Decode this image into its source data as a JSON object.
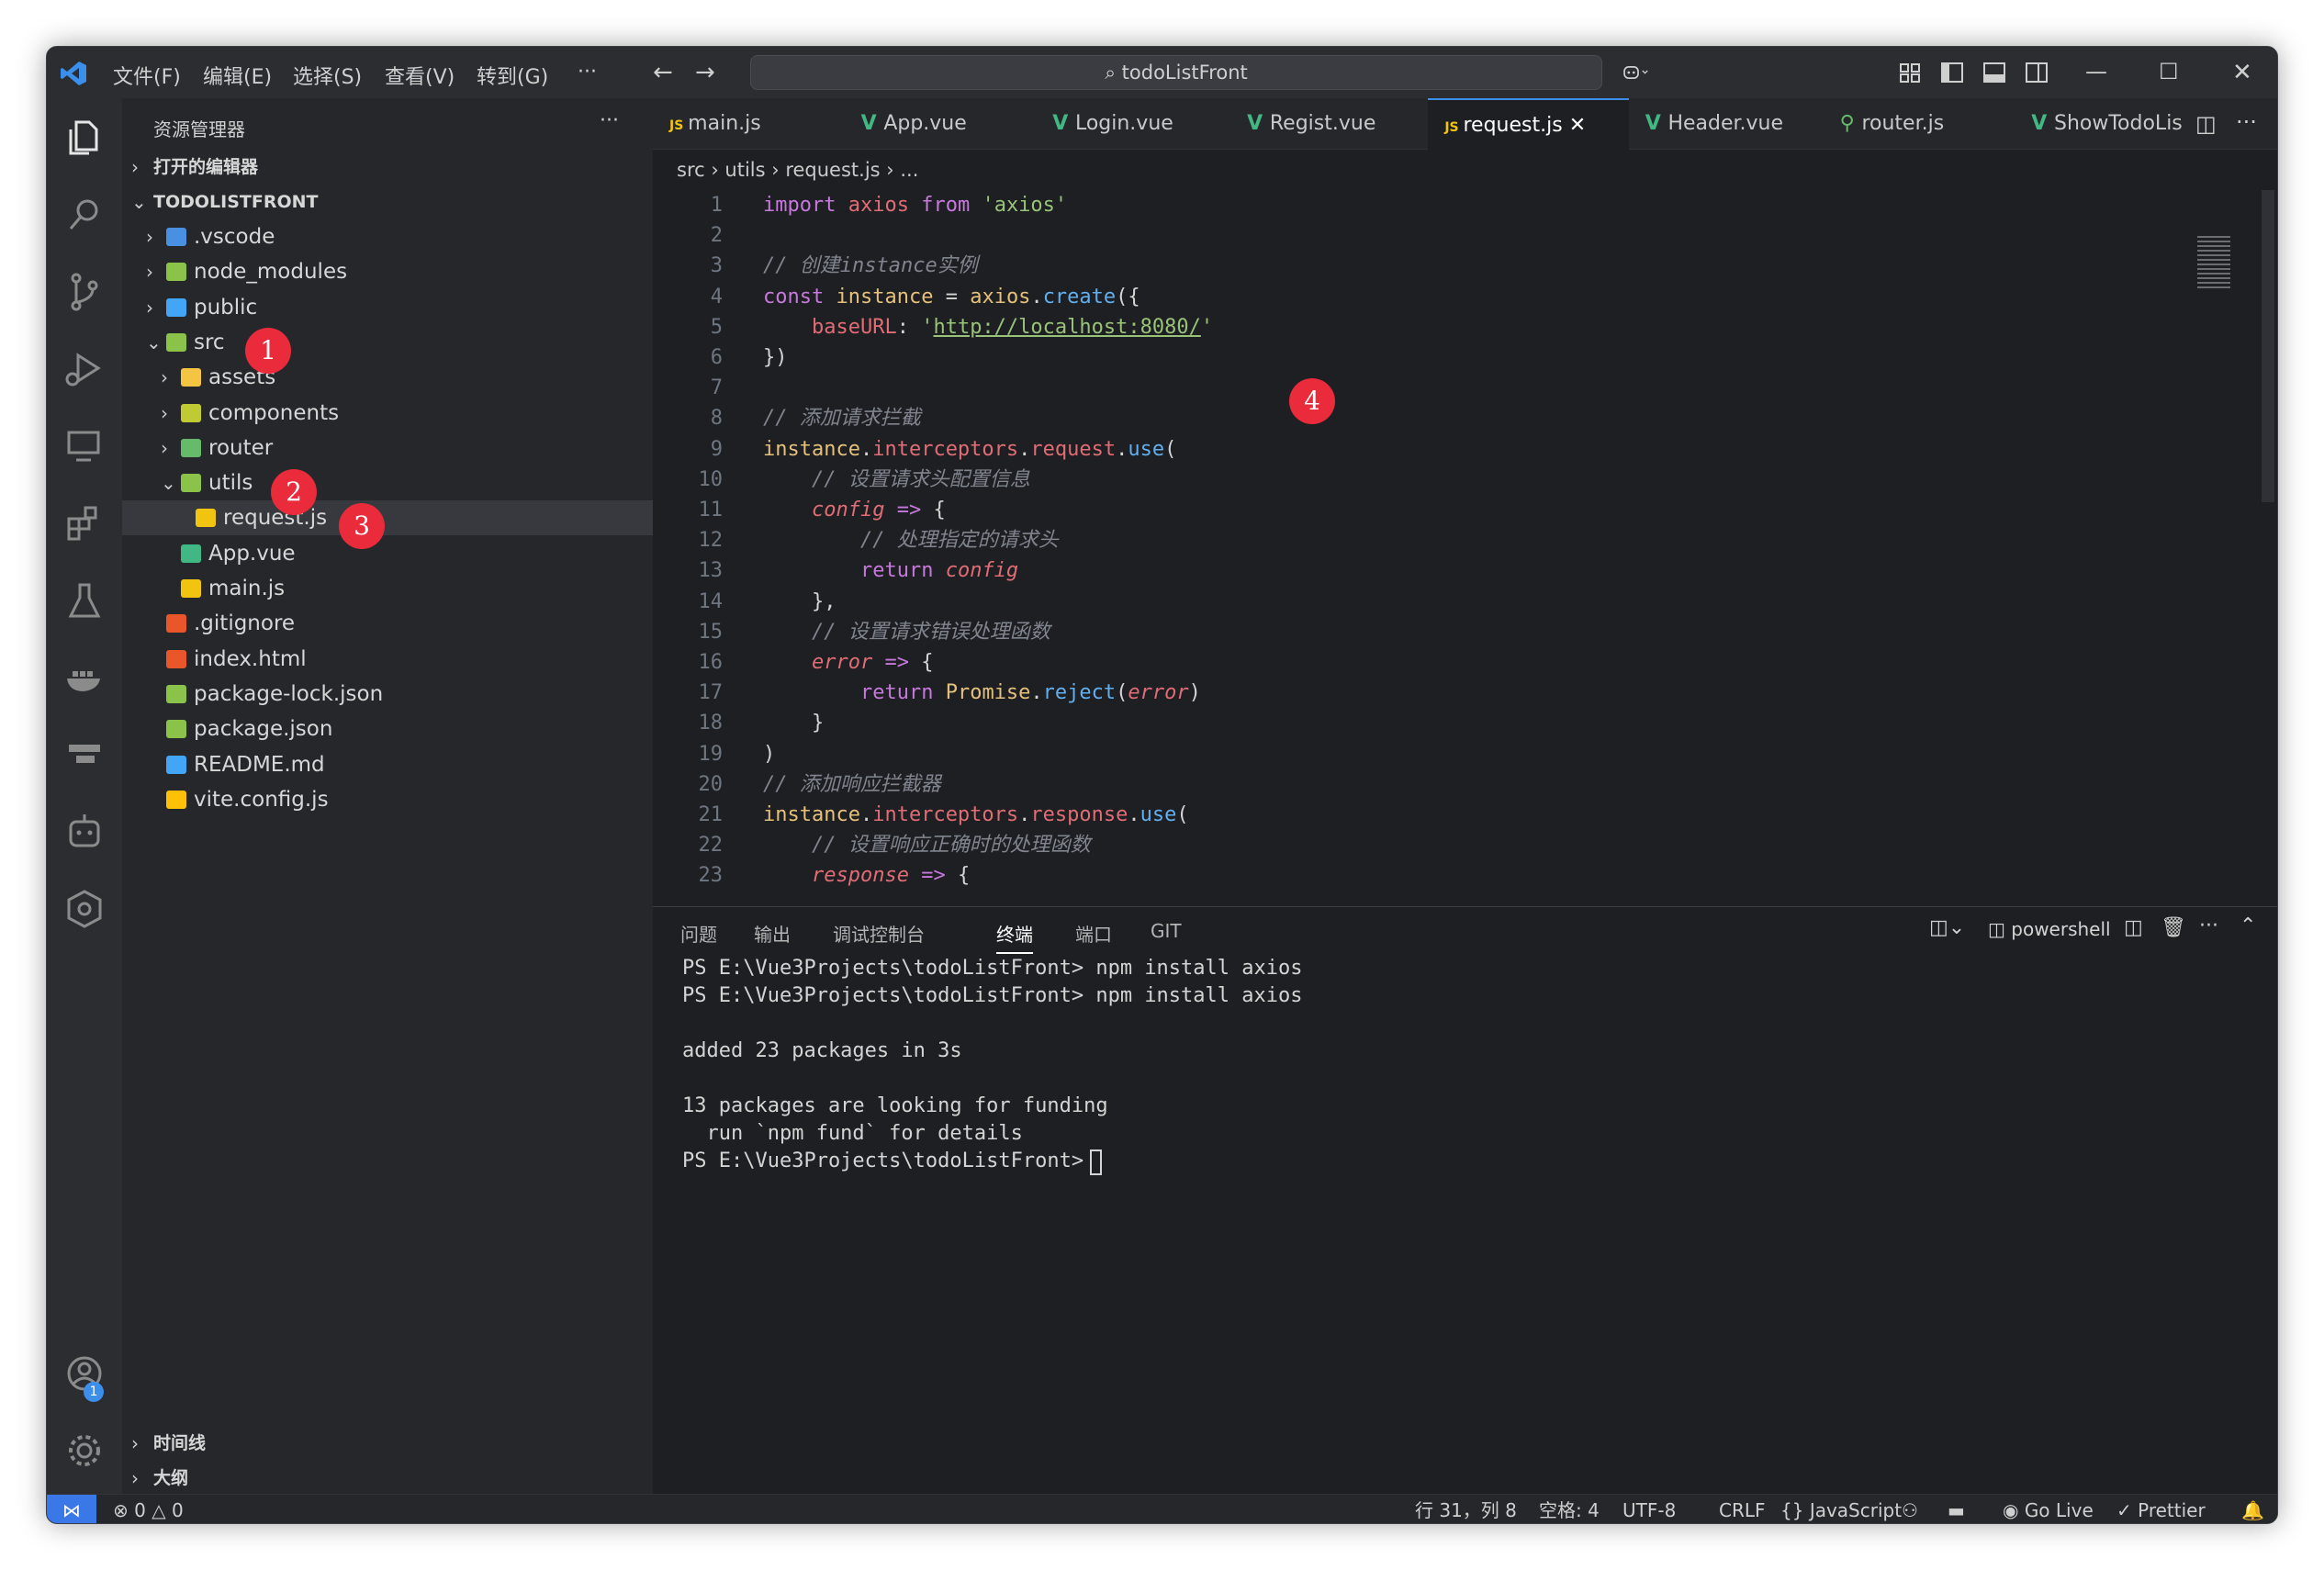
{
  "titlebar": {
    "menus": [
      "文件(F)",
      "编辑(E)",
      "选择(S)",
      "查看(V)",
      "转到(G)",
      "···"
    ],
    "search_text": "todoListFront"
  },
  "sidebar": {
    "header": "资源管理器",
    "more": "···",
    "open_editors": "打开的编辑器",
    "project": "TODOLISTFRONT",
    "tree": [
      {
        "label": ".vscode",
        "level": 1,
        "chev": "›",
        "color": "#4a90e2"
      },
      {
        "label": "node_modules",
        "level": 1,
        "chev": "›",
        "color": "#8bc34a"
      },
      {
        "label": "public",
        "level": 1,
        "chev": "›",
        "color": "#42a5f5"
      },
      {
        "label": "src",
        "level": 1,
        "chev": "⌄",
        "color": "#8bc34a"
      },
      {
        "label": "assets",
        "level": 2,
        "chev": "›",
        "color": "#f4c542"
      },
      {
        "label": "components",
        "level": 2,
        "chev": "›",
        "color": "#c0ca33"
      },
      {
        "label": "router",
        "level": 2,
        "chev": "›",
        "color": "#66bb6a"
      },
      {
        "label": "utils",
        "level": 2,
        "chev": "⌄",
        "color": "#8bc34a"
      },
      {
        "label": "request.js",
        "level": 3,
        "chev": "",
        "color": "#f1c40f"
      },
      {
        "label": "App.vue",
        "level": 2,
        "chev": "",
        "color": "#41b883"
      },
      {
        "label": "main.js",
        "level": 2,
        "chev": "",
        "color": "#f1c40f"
      },
      {
        "label": ".gitignore",
        "level": 1,
        "chev": "",
        "color": "#e8562a"
      },
      {
        "label": "index.html",
        "level": 1,
        "chev": "",
        "color": "#e8562a"
      },
      {
        "label": "package-lock.json",
        "level": 1,
        "chev": "",
        "color": "#8bc34a"
      },
      {
        "label": "package.json",
        "level": 1,
        "chev": "",
        "color": "#8bc34a"
      },
      {
        "label": "README.md",
        "level": 1,
        "chev": "",
        "color": "#42a5f5"
      },
      {
        "label": "vite.config.js",
        "level": 1,
        "chev": "",
        "color": "#ffc107"
      }
    ],
    "outline": "大纲",
    "timeline": "时间线"
  },
  "badges": [
    "1",
    "2",
    "3",
    "4"
  ],
  "tabs": [
    {
      "label": "main.js",
      "icon": "JS",
      "color": "#f1c40f"
    },
    {
      "label": "App.vue",
      "icon": "V",
      "color": "#41b883"
    },
    {
      "label": "Login.vue",
      "icon": "V",
      "color": "#41b883"
    },
    {
      "label": "Regist.vue",
      "icon": "V",
      "color": "#41b883"
    },
    {
      "label": "request.js",
      "icon": "JS",
      "color": "#f1c40f",
      "active": true
    },
    {
      "label": "Header.vue",
      "icon": "V",
      "color": "#41b883"
    },
    {
      "label": "router.js",
      "icon": "⚲",
      "color": "#66bb6a"
    },
    {
      "label": "ShowTodoLis",
      "icon": "V",
      "color": "#41b883"
    }
  ],
  "breadcrumb": [
    "src",
    "utils",
    "request.js",
    "..."
  ],
  "code": [
    "<span class=k>import</span> <span class=r>axios</span> <span class=k>from</span> <span class=s>'axios'</span>",
    "",
    "<span class=c>// 创建instance实例</span>",
    "<span class=k>const</span> <span class=y>instance</span> = <span class=y>axios</span>.<span class=f>create</span>({",
    "    <span class=r>baseURL</span>: <span class=s>'<u>http://localhost:8080/</u>'</span>",
    "})",
    "",
    "<span class=c>// 添加请求拦截</span>",
    "<span class=y>instance</span>.<span class=r>interceptors</span>.<span class=r>request</span>.<span class=f>use</span>(",
    "    <span class=c>// 设置请求头配置信息</span>",
    "    <span class=v>config</span> <span class=k>=&gt;</span> {",
    "        <span class=c>// 处理指定的请求头</span>",
    "        <span class=k>return</span> <span class=v>config</span>",
    "    },",
    "    <span class=c>// 设置请求错误处理函数</span>",
    "    <span class=v>error</span> <span class=k>=&gt;</span> {",
    "        <span class=k>return</span> <span class=y>Promise</span>.<span class=f>reject</span>(<span class=v>error</span>)",
    "    }",
    ")",
    "<span class=c>// 添加响应拦截器</span>",
    "<span class=y>instance</span>.<span class=r>interceptors</span>.<span class=r>response</span>.<span class=f>use</span>(",
    "    <span class=c>// 设置响应正确时的处理函数</span>",
    "    <span class=v>response</span> <span class=k>=&gt;</span> {"
  ],
  "panel": {
    "tabs": [
      "问题",
      "输出",
      "调试控制台",
      "终端",
      "端口",
      "GIT"
    ],
    "active_tab": "终端",
    "shell": "powershell",
    "terminal_lines": [
      "PS E:\\Vue3Projects\\todoListFront> npm install axios",
      "PS E:\\Vue3Projects\\todoListFront> npm install axios",
      "",
      "added 23 packages in 3s",
      "",
      "13 packages are looking for funding",
      "  run `npm fund` for details",
      "PS E:\\Vue3Projects\\todoListFront> "
    ]
  },
  "statusbar": {
    "errors": "0",
    "warnings": "0",
    "position": "行 31，列 8",
    "spaces": "空格: 4",
    "encoding": "UTF-8",
    "eol": "CRLF",
    "language": "JavaScript",
    "golive": "Go Live",
    "prettier": "Prettier"
  },
  "accounts_badge": "1"
}
